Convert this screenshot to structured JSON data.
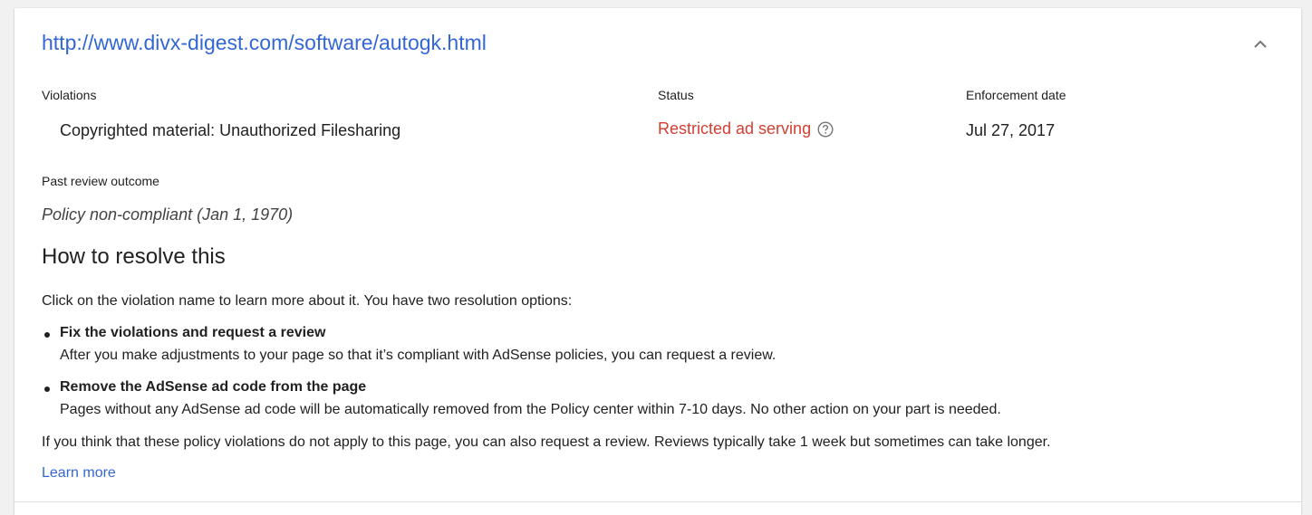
{
  "card": {
    "url": "http://www.divx-digest.com/software/autogk.html",
    "collapse_icon": "chevron-up-icon"
  },
  "columns": {
    "violations_label": "Violations",
    "status_label": "Status",
    "enforcement_label": "Enforcement date"
  },
  "row": {
    "violation": "Copyrighted material: Unauthorized Filesharing",
    "status": "Restricted ad serving",
    "status_color": "#d23f31",
    "help_icon": "help-circle-icon",
    "enforcement_date": "Jul 27, 2017"
  },
  "past_review": {
    "label": "Past review outcome",
    "value": "Policy non-compliant (Jan 1, 1970)"
  },
  "resolve": {
    "heading": "How to resolve this",
    "intro": "Click on the violation name to learn more about it. You have two resolution options:",
    "options": [
      {
        "title": "Fix the violations and request a review",
        "description": "After you make adjustments to your page so that it’s compliant with AdSense policies, you can request a review."
      },
      {
        "title": "Remove the AdSense ad code from the page",
        "description": "Pages without any AdSense ad code will be automatically removed from the Policy center within 7-10 days. No other action on your part is needed."
      }
    ],
    "footer": "If you think that these policy violations do not apply to this page, you can also request a review. Reviews typically take 1 week but sometimes can take longer.",
    "learn_more": "Learn more"
  },
  "colors": {
    "link": "#3367d6",
    "text": "#212121"
  }
}
